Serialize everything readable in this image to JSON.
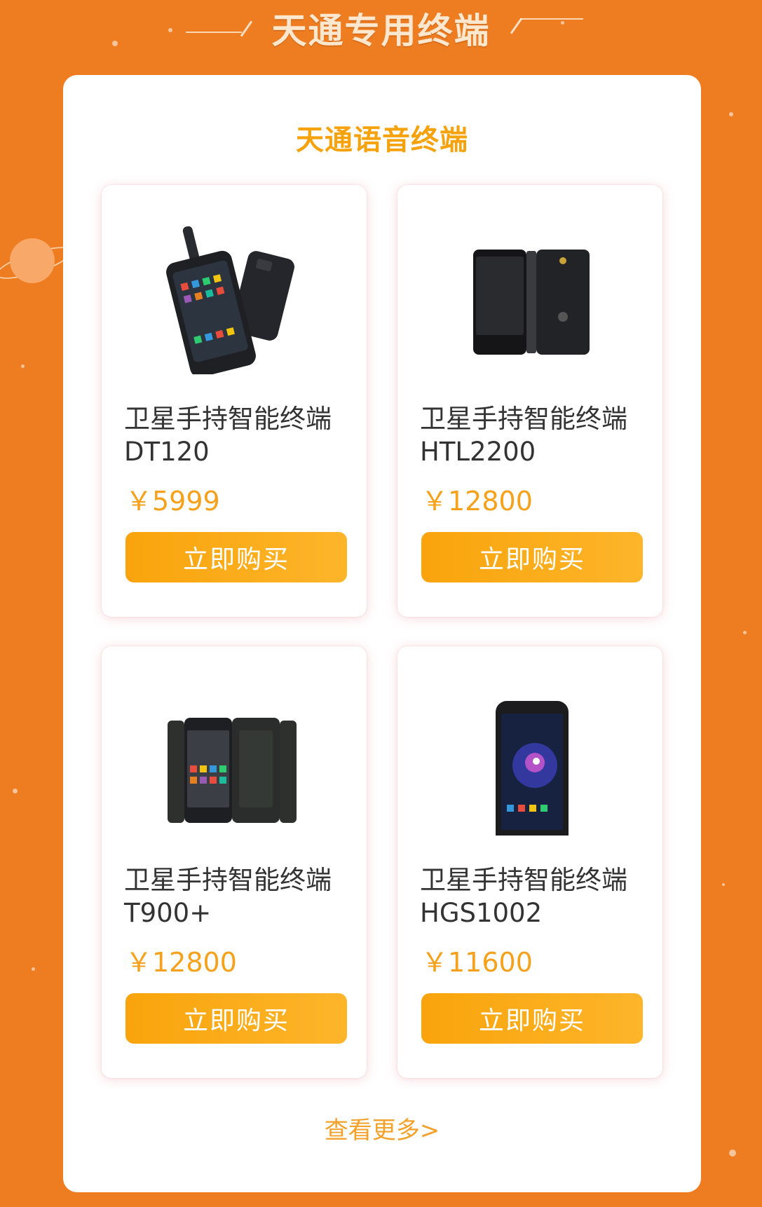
{
  "header": {
    "title": "天通专用终端"
  },
  "panel": {
    "title": "天通语音终端"
  },
  "products": [
    {
      "name": "卫星手持智能终端",
      "model": "DT120",
      "price": "￥5999",
      "button": "立即购买"
    },
    {
      "name": "卫星手持智能终端",
      "model": "HTL2200",
      "price": "￥12800",
      "button": "立即购买"
    },
    {
      "name": "卫星手持智能终端",
      "model": "T900+",
      "price": "￥12800",
      "button": "立即购买"
    },
    {
      "name": "卫星手持智能终端",
      "model": "HGS1002",
      "price": "￥11600",
      "button": "立即购买"
    }
  ],
  "more": {
    "label": "查看更多>"
  },
  "colors": {
    "background": "#ee7d22",
    "accent": "#f5a20c",
    "button": "#f9a40c"
  }
}
